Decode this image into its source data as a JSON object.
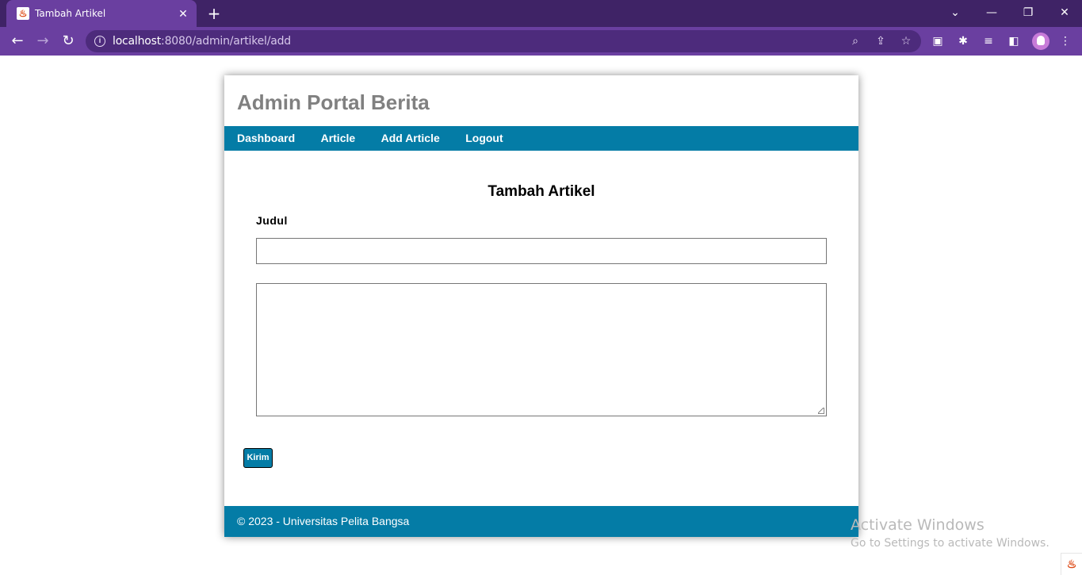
{
  "browser": {
    "tab_title": "Tambah Artikel",
    "url_host": "localhost",
    "url_path": ":8080/admin/artikel/add",
    "theme_color": "#6a3fa0"
  },
  "site": {
    "title": "Admin Portal Berita",
    "nav": [
      {
        "label": "Dashboard"
      },
      {
        "label": "Article"
      },
      {
        "label": "Add Article"
      },
      {
        "label": "Logout"
      }
    ],
    "accent_color": "#047ca6"
  },
  "form": {
    "title": "Tambah Artikel",
    "judul_label": "Judul",
    "judul_value": "",
    "isi_value": "",
    "submit_label": "Kirim"
  },
  "footer": {
    "text": "© 2023 - Universitas Pelita Bangsa"
  },
  "watermark": {
    "title": "Activate Windows",
    "subtitle": "Go to Settings to activate Windows."
  }
}
